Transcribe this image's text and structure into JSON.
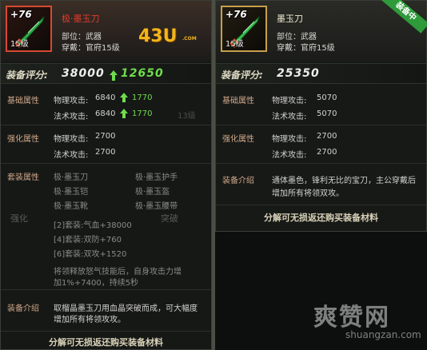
{
  "left": {
    "item": {
      "plus": "+76",
      "level": "15级",
      "name": "极·墨玉刀",
      "slot": "部位：武器",
      "req": "穿戴：官府15级"
    },
    "logo": "43U",
    "logo_sub": ".COM",
    "score": {
      "label": "装备评分:",
      "value": "38000",
      "up": "12650"
    },
    "basic": {
      "title": "基础属性",
      "rows": [
        {
          "text": "物理攻击:",
          "value": "6840",
          "bonus": "1770"
        },
        {
          "text": "法术攻击:",
          "value": "6840",
          "bonus": "1770"
        }
      ]
    },
    "enhance": {
      "title": "强化属性",
      "rows": [
        {
          "text": "物理攻击:",
          "value": "2700"
        },
        {
          "text": "法术攻击:",
          "value": "2700"
        }
      ]
    },
    "set": {
      "title": "套装属性",
      "items_left": [
        "极·墨玉刀",
        "极·墨玉铠",
        "极·墨玉靴"
      ],
      "items_right": [
        "极·墨玉护手",
        "极·墨玉盔",
        "极·墨玉腰带"
      ],
      "bonuses": [
        "[2]套装:气血+38000",
        "[4]套装:双防+760",
        "[6]套装:双攻+1520"
      ],
      "desc": [
        "将领释放怒气技能后，自身攻击力增",
        "加1%+7400，持续5秒"
      ]
    },
    "intro": {
      "title": "装备介绍",
      "text": [
        "取榴晶墨玉刀用血晶突破而成，可大幅度",
        "增加所有将领攻攻。"
      ]
    },
    "footer": "分解可无损返还购买装备材料"
  },
  "right": {
    "item": {
      "plus": "+76",
      "level": "15级",
      "name": "墨玉刀",
      "slot": "部位：武器",
      "req": "穿戴：官府15级"
    },
    "badge": "装备中",
    "score": {
      "label": "装备评分:",
      "value": "25350"
    },
    "basic": {
      "title": "基础属性",
      "rows": [
        {
          "text": "物理攻击:",
          "value": "5070"
        },
        {
          "text": "法术攻击:",
          "value": "5070"
        }
      ]
    },
    "enhance": {
      "title": "强化属性",
      "rows": [
        {
          "text": "物理攻击:",
          "value": "2700"
        },
        {
          "text": "法术攻击:",
          "value": "2700"
        }
      ]
    },
    "intro": {
      "title": "装备介绍",
      "text": [
        "通体墨色，锋利无比的宝刀，主公穿戴后",
        "增加所有将领双攻。"
      ]
    },
    "footer": "分解可无损返还购买装备材料"
  },
  "background": {
    "ghost_strengthen": "强化",
    "ghost_breakthrough": "突破",
    "ghost_level": "13级"
  },
  "watermark": {
    "main": "爽赞网",
    "sub": "shuangzan.com"
  },
  "colors": {
    "red_name": "#e23b2e",
    "green_up": "#6fdc4e",
    "badge": "#2e9a3a",
    "logo": "#f3b51a"
  }
}
